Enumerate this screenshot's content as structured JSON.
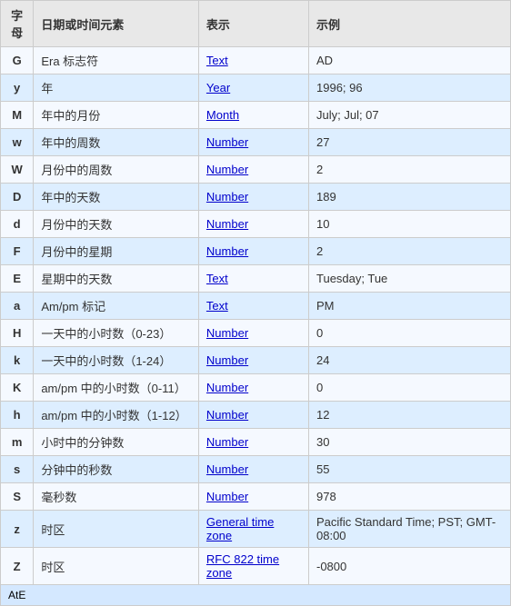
{
  "headers": {
    "char": "字母",
    "desc": "日期或时间元素",
    "repr": "表示",
    "example": "示例"
  },
  "rows": [
    {
      "char": "G",
      "desc": "Era 标志符",
      "repr": "Text",
      "repr_link": true,
      "example": "AD"
    },
    {
      "char": "y",
      "desc": "年",
      "repr": "Year",
      "repr_link": true,
      "example": "1996; 96"
    },
    {
      "char": "M",
      "desc": "年中的月份",
      "repr": "Month",
      "repr_link": true,
      "example": "July; Jul; 07"
    },
    {
      "char": "w",
      "desc": "年中的周数",
      "repr": "Number",
      "repr_link": true,
      "example": "27"
    },
    {
      "char": "W",
      "desc": "月份中的周数",
      "repr": "Number",
      "repr_link": true,
      "example": "2"
    },
    {
      "char": "D",
      "desc": "年中的天数",
      "repr": "Number",
      "repr_link": true,
      "example": "189"
    },
    {
      "char": "d",
      "desc": "月份中的天数",
      "repr": "Number",
      "repr_link": true,
      "example": "10"
    },
    {
      "char": "F",
      "desc": "月份中的星期",
      "repr": "Number",
      "repr_link": true,
      "example": "2"
    },
    {
      "char": "E",
      "desc": "星期中的天数",
      "repr": "Text",
      "repr_link": true,
      "example": "Tuesday; Tue"
    },
    {
      "char": "a",
      "desc": "Am/pm 标记",
      "repr": "Text",
      "repr_link": true,
      "example": "PM"
    },
    {
      "char": "H",
      "desc": "一天中的小时数（0-23）",
      "repr": "Number",
      "repr_link": true,
      "example": "0"
    },
    {
      "char": "k",
      "desc": "一天中的小时数（1-24）",
      "repr": "Number",
      "repr_link": true,
      "example": "24"
    },
    {
      "char": "K",
      "desc": "am/pm 中的小时数（0-11）",
      "repr": "Number",
      "repr_link": true,
      "example": "0"
    },
    {
      "char": "h",
      "desc": "am/pm 中的小时数（1-12）",
      "repr": "Number",
      "repr_link": true,
      "example": "12"
    },
    {
      "char": "m",
      "desc": "小时中的分钟数",
      "repr": "Number",
      "repr_link": true,
      "example": "30"
    },
    {
      "char": "s",
      "desc": "分钟中的秒数",
      "repr": "Number",
      "repr_link": true,
      "example": "55"
    },
    {
      "char": "S",
      "desc": "毫秒数",
      "repr": "Number",
      "repr_link": true,
      "example": "978"
    },
    {
      "char": "z",
      "desc": "时区",
      "repr": "General time zone",
      "repr_link": true,
      "example": "Pacific Standard Time; PST; GMT-08:00"
    },
    {
      "char": "Z",
      "desc": "时区",
      "repr": "RFC 822 time zone",
      "repr_link": true,
      "example": "-0800"
    }
  ],
  "footer": {
    "label": "AtE"
  }
}
